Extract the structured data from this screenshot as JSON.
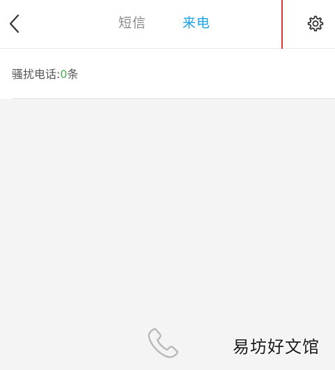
{
  "header": {
    "tabs": [
      {
        "label": "短信",
        "color": "#8a8a8a",
        "active": false
      },
      {
        "label": "来电",
        "color": "#1aa3e8",
        "active": true
      }
    ]
  },
  "summary": {
    "label": "骚扰电话:",
    "count": "0",
    "unit": "条",
    "count_color": "#4caf50"
  },
  "icons": {
    "back": "chevron-left-icon",
    "settings": "gear-icon",
    "empty_state": "phone-icon"
  },
  "watermark": {
    "text": "易坊好文馆"
  }
}
